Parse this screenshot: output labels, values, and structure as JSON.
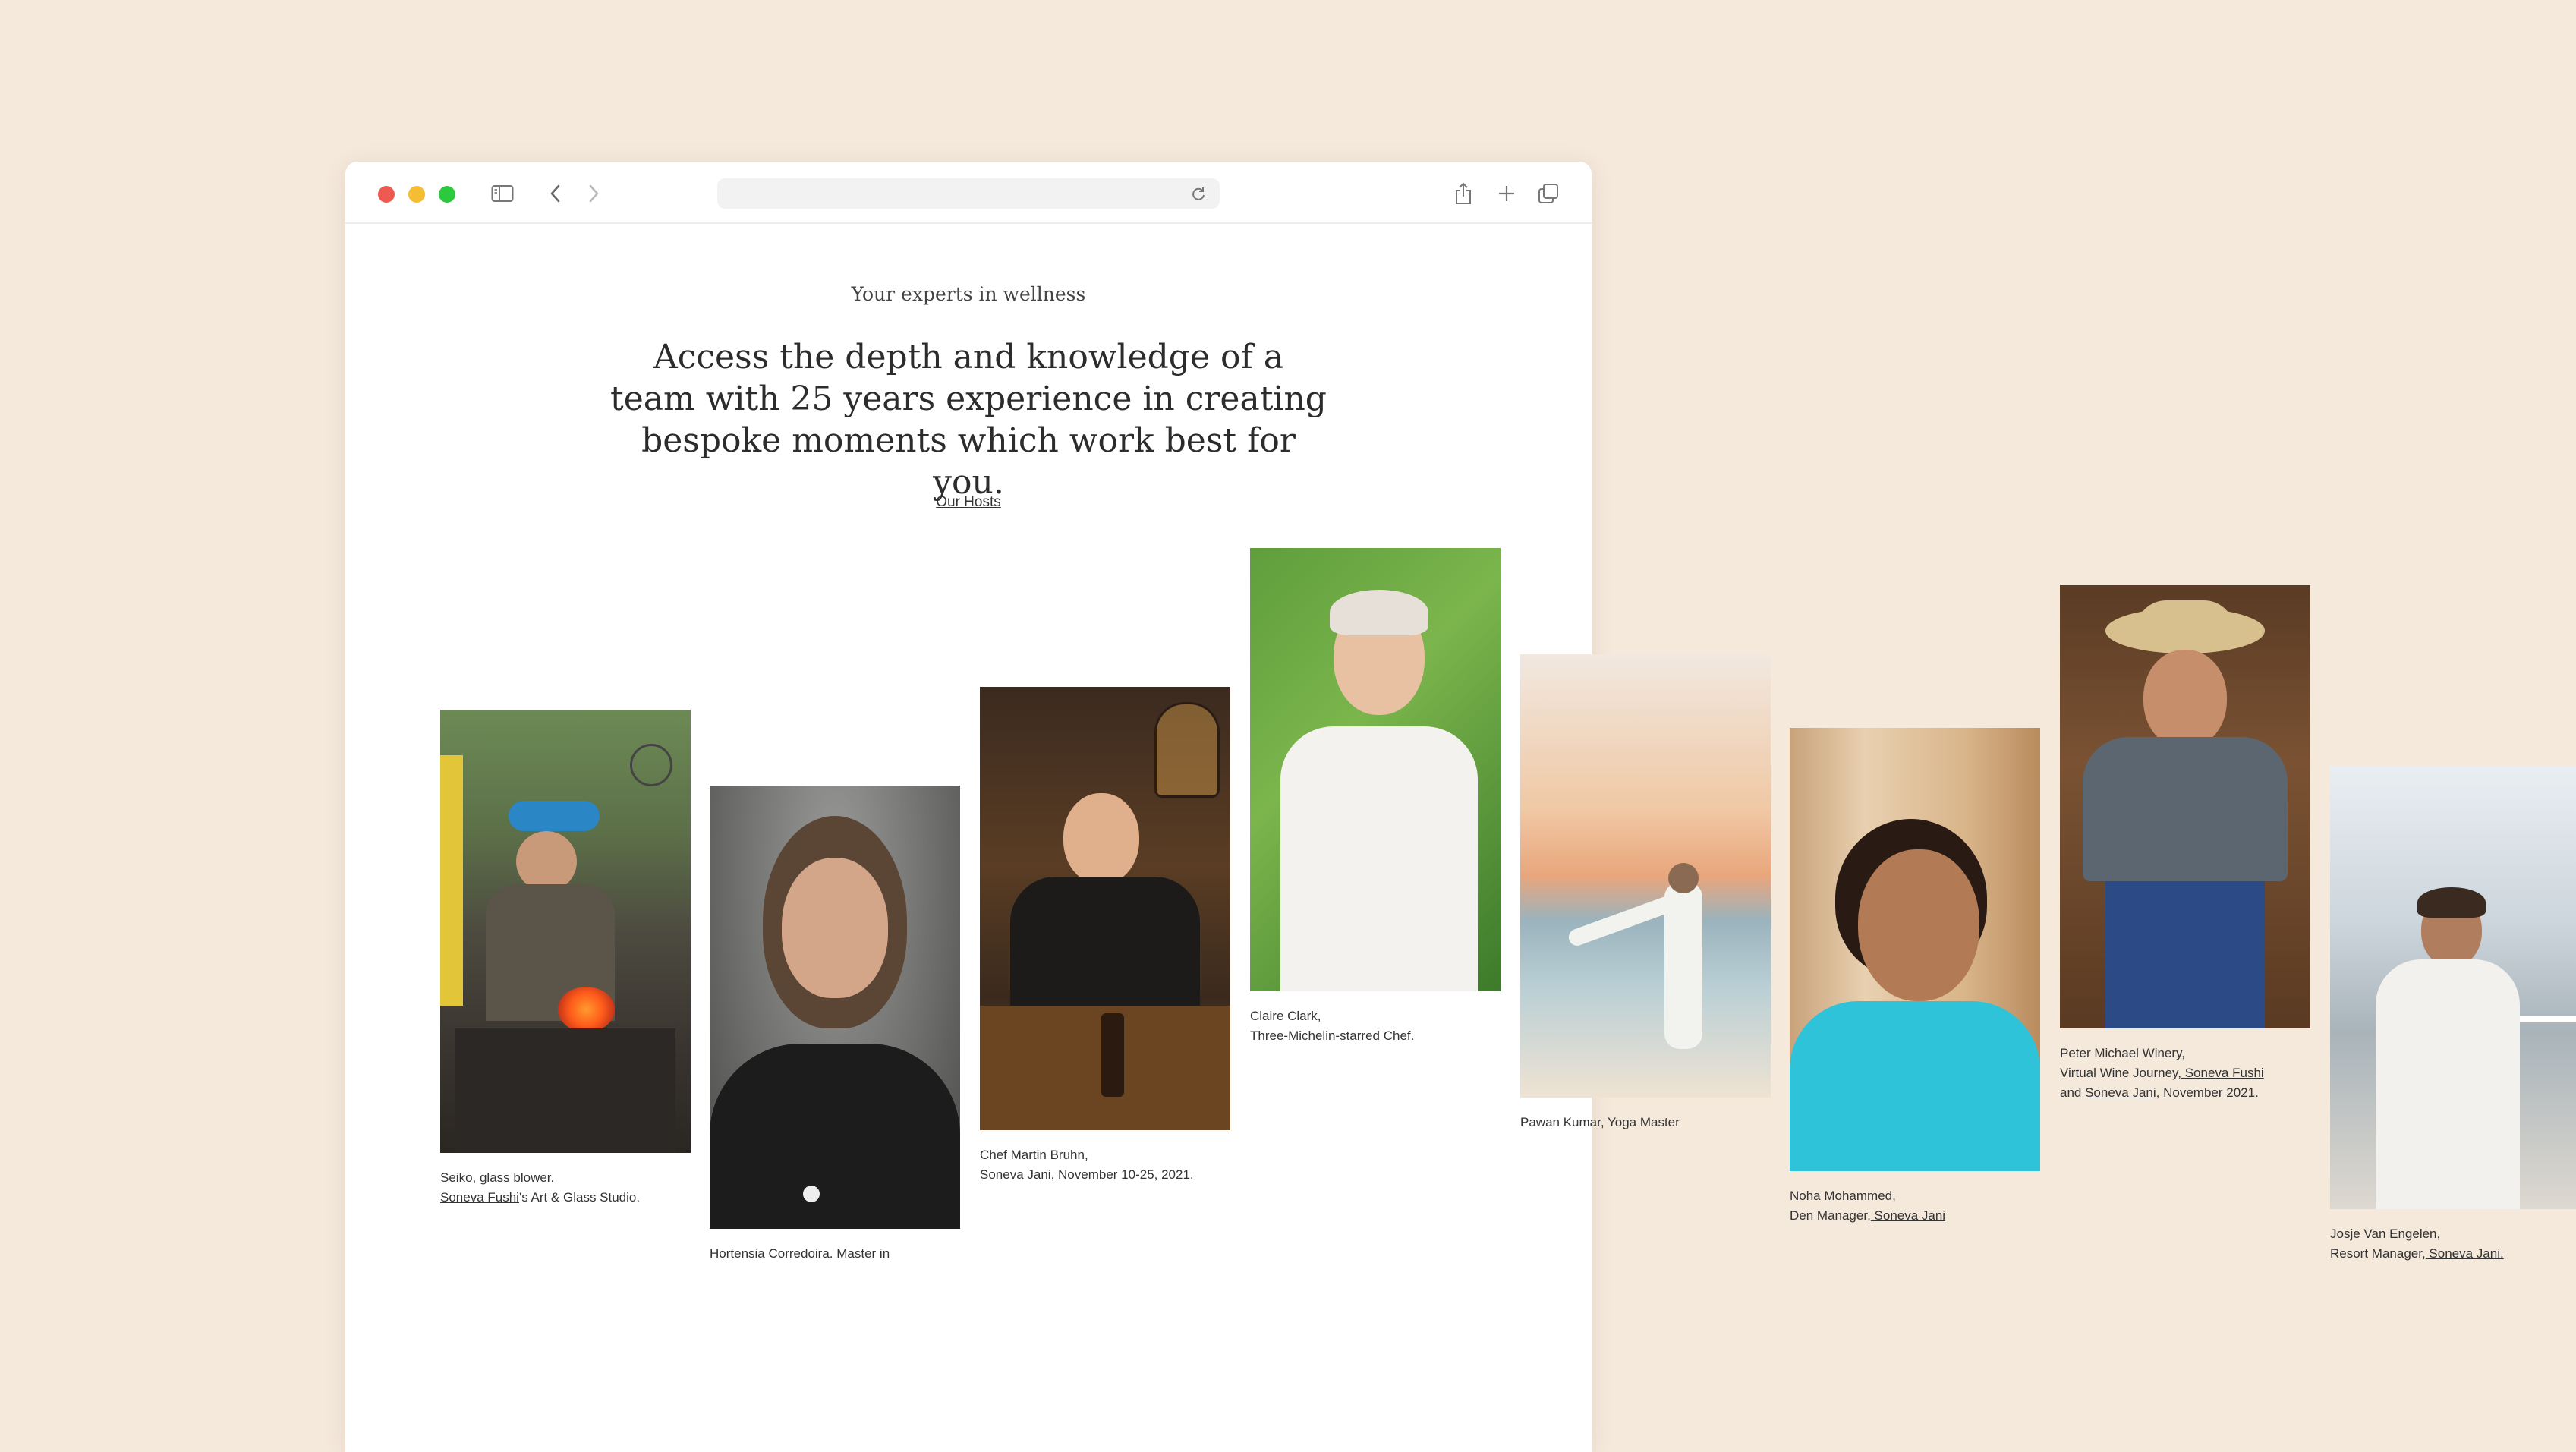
{
  "browser": {
    "traffic_lights": {
      "close": "#ee5a52",
      "minimize": "#f5be32",
      "zoom": "#2cc93f"
    },
    "icons": [
      "sidebar-icon",
      "back-icon",
      "forward-icon",
      "reload-icon",
      "share-icon",
      "new-tab-icon",
      "tabs-overview-icon"
    ]
  },
  "page": {
    "eyebrow": "Your experts in wellness",
    "headline": "Access the depth and knowledge of a team with 25 years experience in creating bespoke moments which work best for you.",
    "hosts_link": "Our Hosts"
  },
  "hosts": [
    {
      "line1": "Seiko, glass blower.",
      "line2_link": "Soneva Fushi",
      "line2_text": "'s Art & Glass Studio.",
      "line3_pre": "",
      "line3_link": "",
      "line3_post": ""
    },
    {
      "line1": "Hortensia Corredoira. Master in",
      "line2_link": "",
      "line2_text": "",
      "line3_pre": "",
      "line3_link": "",
      "line3_post": ""
    },
    {
      "line1": "Chef Martin Bruhn,",
      "line2_link": "Soneva Jani",
      "line2_text": ", November 10-25, 2021.",
      "line3_pre": "",
      "line3_link": "",
      "line3_post": ""
    },
    {
      "line1": "Claire Clark,",
      "line2_link": "",
      "line2_text": "Three-Michelin-starred Chef.",
      "line3_pre": "",
      "line3_link": "",
      "line3_post": ""
    },
    {
      "line1": "Pawan Kumar, Yoga Master",
      "line2_link": "",
      "line2_text": "",
      "line3_pre": "",
      "line3_link": "",
      "line3_post": ""
    },
    {
      "line1": "Noha Mohammed,",
      "line2_pre": "Den Manager,",
      "line2_link": " Soneva Jani",
      "line2_text": "",
      "line3_pre": "",
      "line3_link": "",
      "line3_post": ""
    },
    {
      "line1": "Peter Michael Winery,",
      "line2_pre": "Virtual Wine Journey,",
      "line2_link": " Soneva Fushi",
      "line2_text": "",
      "line3_pre": "and ",
      "line3_link": "Soneva Jani",
      "line3_post": ", November 2021."
    },
    {
      "line1": "Josje Van Engelen,",
      "line2_pre": "Resort Manager,",
      "line2_link": " Soneva Jani.",
      "line2_text": "",
      "line3_pre": "",
      "line3_link": "",
      "line3_post": ""
    }
  ]
}
